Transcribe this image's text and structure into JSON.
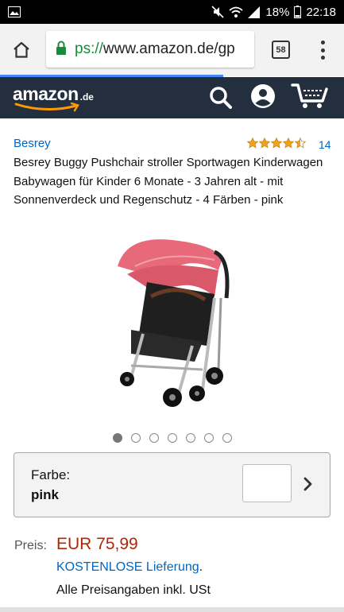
{
  "status_bar": {
    "battery": "18%",
    "time": "22:18",
    "icons": [
      "image-icon",
      "mute-icon",
      "wifi-icon",
      "signal-icon",
      "battery-icon"
    ]
  },
  "browser": {
    "url_prefix": "ps://",
    "url_main": "www.amazon.de/gp",
    "tab_count": "58",
    "load_progress": 0.65
  },
  "header": {
    "logo_word": "amazon",
    "logo_tld": ".de",
    "colors": {
      "bar": "#232f3e",
      "smile": "#ff9900"
    }
  },
  "product": {
    "brand": "Besrey",
    "rating_stars": 4.5,
    "rating_count": "14",
    "title": "Besrey Buggy Pushchair stroller Sportwagen Kinderwagen Babywagen für Kinder 6 Monate - 3 Jahren alt - mit Sonnenverdeck und Regenschutz - 4 Färben - pink",
    "image_count": 7,
    "active_image": 0
  },
  "variation": {
    "label": "Farbe:",
    "value": "pink"
  },
  "pricing": {
    "label": "Preis:",
    "price": "EUR 75,99",
    "shipping_link": "KOSTENLOSE Lieferung",
    "shipping_suffix": ".",
    "vat_note": "Alle Preisangaben inkl. USt"
  },
  "colors": {
    "link": "#0066c0",
    "price": "#b12704",
    "star": "#f0a41c",
    "canopy": "#e86a7a"
  }
}
